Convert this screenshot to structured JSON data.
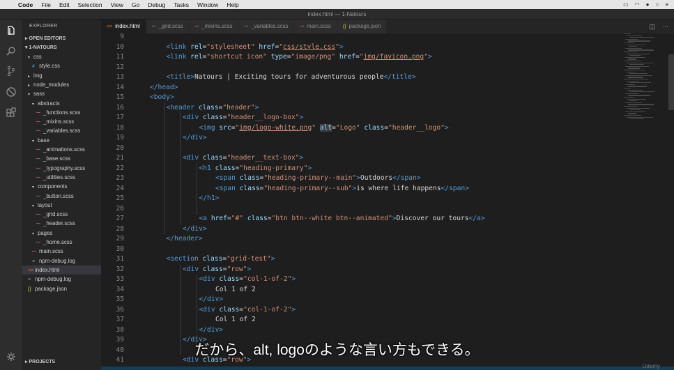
{
  "menubar": {
    "app": "Code",
    "items": [
      "File",
      "Edit",
      "Selection",
      "View",
      "Go",
      "Debug",
      "Tasks",
      "Window",
      "Help"
    ]
  },
  "window": {
    "title": "index.html — 1-Natours"
  },
  "sidebar": {
    "title": "EXPLORER",
    "open_editors": "OPEN EDITORS",
    "project": "1-NATOURS",
    "projects_section": "PROJECTS",
    "tree": [
      {
        "label": "css",
        "depth": 1,
        "kind": "folder",
        "open": true
      },
      {
        "label": "style.css",
        "depth": 2,
        "kind": "css"
      },
      {
        "label": "img",
        "depth": 1,
        "kind": "folder",
        "open": false
      },
      {
        "label": "node_modules",
        "depth": 1,
        "kind": "folder",
        "open": false
      },
      {
        "label": "sass",
        "depth": 1,
        "kind": "folder",
        "open": true
      },
      {
        "label": "abstracts",
        "depth": 2,
        "kind": "folder",
        "open": true
      },
      {
        "label": "_functions.scss",
        "depth": 3,
        "kind": "scss"
      },
      {
        "label": "_mixins.scss",
        "depth": 3,
        "kind": "scss"
      },
      {
        "label": "_variables.scss",
        "depth": 3,
        "kind": "scss"
      },
      {
        "label": "base",
        "depth": 2,
        "kind": "folder",
        "open": true
      },
      {
        "label": "_animations.scss",
        "depth": 3,
        "kind": "scss"
      },
      {
        "label": "_base.scss",
        "depth": 3,
        "kind": "scss"
      },
      {
        "label": "_typography.scss",
        "depth": 3,
        "kind": "scss"
      },
      {
        "label": "_utilities.scss",
        "depth": 3,
        "kind": "scss"
      },
      {
        "label": "components",
        "depth": 2,
        "kind": "folder",
        "open": true
      },
      {
        "label": "_button.scss",
        "depth": 3,
        "kind": "scss"
      },
      {
        "label": "layout",
        "depth": 2,
        "kind": "folder",
        "open": true
      },
      {
        "label": "_grid.scss",
        "depth": 3,
        "kind": "scss"
      },
      {
        "label": "_header.scss",
        "depth": 3,
        "kind": "scss"
      },
      {
        "label": "pages",
        "depth": 2,
        "kind": "folder",
        "open": true
      },
      {
        "label": "_home.scss",
        "depth": 3,
        "kind": "scss"
      },
      {
        "label": "main.scss",
        "depth": 2,
        "kind": "scss"
      },
      {
        "label": "npm-debug.log",
        "depth": 2,
        "kind": "log"
      },
      {
        "label": "index.html",
        "depth": 1,
        "kind": "html",
        "selected": true
      },
      {
        "label": "npm-debug.log",
        "depth": 1,
        "kind": "log"
      },
      {
        "label": "package.json",
        "depth": 1,
        "kind": "json"
      }
    ]
  },
  "tabs": [
    {
      "label": "index.html",
      "kind": "html",
      "active": true
    },
    {
      "label": "_grid.scss",
      "kind": "scss"
    },
    {
      "label": "_mixins.scss",
      "kind": "scss"
    },
    {
      "label": "_variables.scss",
      "kind": "scss"
    },
    {
      "label": "main.scss",
      "kind": "scss"
    },
    {
      "label": "package.json",
      "kind": "json"
    }
  ],
  "editor": {
    "lines": [
      {
        "n": "9",
        "indent": 0,
        "segs": []
      },
      {
        "n": "10",
        "indent": 1,
        "segs": [
          [
            "tg",
            "<link "
          ],
          [
            "at",
            "rel"
          ],
          [
            "tx",
            "="
          ],
          [
            "st",
            "\"stylesheet\" "
          ],
          [
            "at",
            "href"
          ],
          [
            "tx",
            "="
          ],
          [
            "st",
            "\""
          ],
          [
            "stu",
            "css/style.css"
          ],
          [
            "st",
            "\""
          ],
          [
            "tg",
            ">"
          ]
        ]
      },
      {
        "n": "11",
        "indent": 1,
        "segs": [
          [
            "tg",
            "<link "
          ],
          [
            "at",
            "rel"
          ],
          [
            "tx",
            "="
          ],
          [
            "st",
            "\"shortcut icon\" "
          ],
          [
            "at",
            "type"
          ],
          [
            "tx",
            "="
          ],
          [
            "st",
            "\"image/png\" "
          ],
          [
            "at",
            "href"
          ],
          [
            "tx",
            "="
          ],
          [
            "st",
            "\""
          ],
          [
            "stu",
            "img/favicon.png"
          ],
          [
            "st",
            "\""
          ],
          [
            "tg",
            ">"
          ]
        ]
      },
      {
        "n": "12",
        "indent": 0,
        "segs": []
      },
      {
        "n": "13",
        "indent": 1,
        "segs": [
          [
            "tg",
            "<title>"
          ],
          [
            "tx",
            "Natours | Exciting tours for adventurous people"
          ],
          [
            "tg",
            "</title>"
          ]
        ]
      },
      {
        "n": "14",
        "indent": 0,
        "segs": [
          [
            "tg",
            "</head>"
          ]
        ]
      },
      {
        "n": "15",
        "indent": 0,
        "segs": [
          [
            "tg",
            "<body>"
          ]
        ]
      },
      {
        "n": "16",
        "indent": 1,
        "segs": [
          [
            "tg",
            "<header "
          ],
          [
            "at",
            "class"
          ],
          [
            "tx",
            "="
          ],
          [
            "st",
            "\"header\""
          ],
          [
            "tg",
            ">"
          ]
        ]
      },
      {
        "n": "17",
        "indent": 2,
        "segs": [
          [
            "tg",
            "<div "
          ],
          [
            "at",
            "class"
          ],
          [
            "tx",
            "="
          ],
          [
            "st",
            "\"header__logo-box\""
          ],
          [
            "tg",
            ">"
          ]
        ]
      },
      {
        "n": "18",
        "indent": 3,
        "segs": [
          [
            "tg",
            "<img "
          ],
          [
            "at",
            "src"
          ],
          [
            "tx",
            "="
          ],
          [
            "st",
            "\""
          ],
          [
            "stu",
            "img/logo-white.png"
          ],
          [
            "st",
            "\" "
          ],
          [
            "ath",
            "alt"
          ],
          [
            "tx",
            "="
          ],
          [
            "st",
            "\"Logo\" "
          ],
          [
            "at",
            "class"
          ],
          [
            "tx",
            "="
          ],
          [
            "st",
            "\"header__logo\""
          ],
          [
            "tg",
            ">"
          ]
        ]
      },
      {
        "n": "19",
        "indent": 2,
        "segs": [
          [
            "tg",
            "</div>"
          ]
        ]
      },
      {
        "n": "20",
        "indent": 0,
        "segs": []
      },
      {
        "n": "21",
        "indent": 2,
        "segs": [
          [
            "tg",
            "<div "
          ],
          [
            "at",
            "class"
          ],
          [
            "tx",
            "="
          ],
          [
            "st",
            "\"header__text-box\""
          ],
          [
            "tg",
            ">"
          ]
        ]
      },
      {
        "n": "22",
        "indent": 3,
        "segs": [
          [
            "tg",
            "<h1 "
          ],
          [
            "at",
            "class"
          ],
          [
            "tx",
            "="
          ],
          [
            "st",
            "\"heading-primary\""
          ],
          [
            "tg",
            ">"
          ]
        ]
      },
      {
        "n": "23",
        "indent": 4,
        "segs": [
          [
            "tg",
            "<span "
          ],
          [
            "at",
            "class"
          ],
          [
            "tx",
            "="
          ],
          [
            "st",
            "\"heading-primary--main\""
          ],
          [
            "tg",
            ">"
          ],
          [
            "tx",
            "Outdoors"
          ],
          [
            "tg",
            "</span>"
          ]
        ]
      },
      {
        "n": "24",
        "indent": 4,
        "segs": [
          [
            "tg",
            "<span "
          ],
          [
            "at",
            "class"
          ],
          [
            "tx",
            "="
          ],
          [
            "st",
            "\"heading-primary--sub\""
          ],
          [
            "tg",
            ">"
          ],
          [
            "tx",
            "is where life happens"
          ],
          [
            "tg",
            "</span>"
          ]
        ]
      },
      {
        "n": "25",
        "indent": 3,
        "segs": [
          [
            "tg",
            "</h1>"
          ]
        ]
      },
      {
        "n": "26",
        "indent": 0,
        "segs": []
      },
      {
        "n": "27",
        "indent": 3,
        "segs": [
          [
            "tg",
            "<a "
          ],
          [
            "at",
            "href"
          ],
          [
            "tx",
            "="
          ],
          [
            "st",
            "\"#\" "
          ],
          [
            "at",
            "class"
          ],
          [
            "tx",
            "="
          ],
          [
            "st",
            "\"btn btn--white btn--animated\""
          ],
          [
            "tg",
            ">"
          ],
          [
            "tx",
            "Discover our tours"
          ],
          [
            "tg",
            "</a>"
          ]
        ]
      },
      {
        "n": "28",
        "indent": 2,
        "segs": [
          [
            "tg",
            "</div>"
          ]
        ]
      },
      {
        "n": "29",
        "indent": 1,
        "segs": [
          [
            "tg",
            "</header>"
          ]
        ]
      },
      {
        "n": "30",
        "indent": 0,
        "segs": []
      },
      {
        "n": "31",
        "indent": 1,
        "segs": [
          [
            "tg",
            "<section "
          ],
          [
            "at",
            "class"
          ],
          [
            "tx",
            "="
          ],
          [
            "st",
            "\"grid-test\""
          ],
          [
            "tg",
            ">"
          ]
        ]
      },
      {
        "n": "32",
        "indent": 2,
        "segs": [
          [
            "tg",
            "<div "
          ],
          [
            "at",
            "class"
          ],
          [
            "tx",
            "="
          ],
          [
            "st",
            "\"row\""
          ],
          [
            "tg",
            ">"
          ]
        ]
      },
      {
        "n": "33",
        "indent": 3,
        "segs": [
          [
            "tg",
            "<div "
          ],
          [
            "at",
            "class"
          ],
          [
            "tx",
            "="
          ],
          [
            "st",
            "\"col-1-of-2\""
          ],
          [
            "tg",
            ">"
          ]
        ]
      },
      {
        "n": "34",
        "indent": 4,
        "segs": [
          [
            "tx",
            "Col 1 of 2"
          ]
        ]
      },
      {
        "n": "35",
        "indent": 3,
        "segs": [
          [
            "tg",
            "</div>"
          ]
        ]
      },
      {
        "n": "36",
        "indent": 3,
        "segs": [
          [
            "tg",
            "<div "
          ],
          [
            "at",
            "class"
          ],
          [
            "tx",
            "="
          ],
          [
            "st",
            "\"col-1-of-2\""
          ],
          [
            "tg",
            ">"
          ]
        ]
      },
      {
        "n": "37",
        "indent": 4,
        "segs": [
          [
            "tx",
            "Col 1 of 2"
          ]
        ]
      },
      {
        "n": "38",
        "indent": 3,
        "segs": [
          [
            "tg",
            "</div>"
          ]
        ]
      },
      {
        "n": "39",
        "indent": 2,
        "segs": [
          [
            "tg",
            "</div>"
          ]
        ]
      },
      {
        "n": "40",
        "indent": 0,
        "segs": []
      },
      {
        "n": "41",
        "indent": 2,
        "segs": [
          [
            "tg",
            "<div "
          ],
          [
            "at",
            "class"
          ],
          [
            "tx",
            "="
          ],
          [
            "st",
            "\"row\""
          ],
          [
            "tg",
            ">"
          ]
        ]
      }
    ]
  },
  "subtitle": "だから、alt, logoのような言い方もできる。",
  "watermark": "Udemy",
  "colors": {
    "tag": "#569cd6",
    "attribute": "#9cdcfe",
    "string": "#ce9178",
    "text": "#d4d4d4",
    "editor_bg": "#1e1e1e",
    "sidebar_bg": "#252526"
  },
  "icons": {
    "activity": [
      "files-icon",
      "search-icon",
      "source-control-icon",
      "debug-icon",
      "extensions-icon"
    ],
    "settings": "gear-icon"
  }
}
